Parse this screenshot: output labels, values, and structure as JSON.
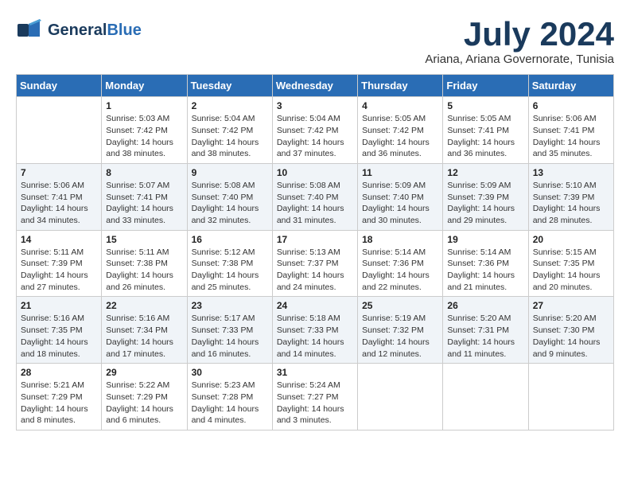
{
  "logo": {
    "text_general": "General",
    "text_blue": "Blue"
  },
  "header": {
    "month": "July 2024",
    "location": "Ariana, Ariana Governorate, Tunisia"
  },
  "columns": [
    "Sunday",
    "Monday",
    "Tuesday",
    "Wednesday",
    "Thursday",
    "Friday",
    "Saturday"
  ],
  "weeks": [
    [
      {
        "day": "",
        "info": ""
      },
      {
        "day": "1",
        "info": "Sunrise: 5:03 AM\nSunset: 7:42 PM\nDaylight: 14 hours\nand 38 minutes."
      },
      {
        "day": "2",
        "info": "Sunrise: 5:04 AM\nSunset: 7:42 PM\nDaylight: 14 hours\nand 38 minutes."
      },
      {
        "day": "3",
        "info": "Sunrise: 5:04 AM\nSunset: 7:42 PM\nDaylight: 14 hours\nand 37 minutes."
      },
      {
        "day": "4",
        "info": "Sunrise: 5:05 AM\nSunset: 7:42 PM\nDaylight: 14 hours\nand 36 minutes."
      },
      {
        "day": "5",
        "info": "Sunrise: 5:05 AM\nSunset: 7:41 PM\nDaylight: 14 hours\nand 36 minutes."
      },
      {
        "day": "6",
        "info": "Sunrise: 5:06 AM\nSunset: 7:41 PM\nDaylight: 14 hours\nand 35 minutes."
      }
    ],
    [
      {
        "day": "7",
        "info": "Sunrise: 5:06 AM\nSunset: 7:41 PM\nDaylight: 14 hours\nand 34 minutes."
      },
      {
        "day": "8",
        "info": "Sunrise: 5:07 AM\nSunset: 7:41 PM\nDaylight: 14 hours\nand 33 minutes."
      },
      {
        "day": "9",
        "info": "Sunrise: 5:08 AM\nSunset: 7:40 PM\nDaylight: 14 hours\nand 32 minutes."
      },
      {
        "day": "10",
        "info": "Sunrise: 5:08 AM\nSunset: 7:40 PM\nDaylight: 14 hours\nand 31 minutes."
      },
      {
        "day": "11",
        "info": "Sunrise: 5:09 AM\nSunset: 7:40 PM\nDaylight: 14 hours\nand 30 minutes."
      },
      {
        "day": "12",
        "info": "Sunrise: 5:09 AM\nSunset: 7:39 PM\nDaylight: 14 hours\nand 29 minutes."
      },
      {
        "day": "13",
        "info": "Sunrise: 5:10 AM\nSunset: 7:39 PM\nDaylight: 14 hours\nand 28 minutes."
      }
    ],
    [
      {
        "day": "14",
        "info": "Sunrise: 5:11 AM\nSunset: 7:39 PM\nDaylight: 14 hours\nand 27 minutes."
      },
      {
        "day": "15",
        "info": "Sunrise: 5:11 AM\nSunset: 7:38 PM\nDaylight: 14 hours\nand 26 minutes."
      },
      {
        "day": "16",
        "info": "Sunrise: 5:12 AM\nSunset: 7:38 PM\nDaylight: 14 hours\nand 25 minutes."
      },
      {
        "day": "17",
        "info": "Sunrise: 5:13 AM\nSunset: 7:37 PM\nDaylight: 14 hours\nand 24 minutes."
      },
      {
        "day": "18",
        "info": "Sunrise: 5:14 AM\nSunset: 7:36 PM\nDaylight: 14 hours\nand 22 minutes."
      },
      {
        "day": "19",
        "info": "Sunrise: 5:14 AM\nSunset: 7:36 PM\nDaylight: 14 hours\nand 21 minutes."
      },
      {
        "day": "20",
        "info": "Sunrise: 5:15 AM\nSunset: 7:35 PM\nDaylight: 14 hours\nand 20 minutes."
      }
    ],
    [
      {
        "day": "21",
        "info": "Sunrise: 5:16 AM\nSunset: 7:35 PM\nDaylight: 14 hours\nand 18 minutes."
      },
      {
        "day": "22",
        "info": "Sunrise: 5:16 AM\nSunset: 7:34 PM\nDaylight: 14 hours\nand 17 minutes."
      },
      {
        "day": "23",
        "info": "Sunrise: 5:17 AM\nSunset: 7:33 PM\nDaylight: 14 hours\nand 16 minutes."
      },
      {
        "day": "24",
        "info": "Sunrise: 5:18 AM\nSunset: 7:33 PM\nDaylight: 14 hours\nand 14 minutes."
      },
      {
        "day": "25",
        "info": "Sunrise: 5:19 AM\nSunset: 7:32 PM\nDaylight: 14 hours\nand 12 minutes."
      },
      {
        "day": "26",
        "info": "Sunrise: 5:20 AM\nSunset: 7:31 PM\nDaylight: 14 hours\nand 11 minutes."
      },
      {
        "day": "27",
        "info": "Sunrise: 5:20 AM\nSunset: 7:30 PM\nDaylight: 14 hours\nand 9 minutes."
      }
    ],
    [
      {
        "day": "28",
        "info": "Sunrise: 5:21 AM\nSunset: 7:29 PM\nDaylight: 14 hours\nand 8 minutes."
      },
      {
        "day": "29",
        "info": "Sunrise: 5:22 AM\nSunset: 7:29 PM\nDaylight: 14 hours\nand 6 minutes."
      },
      {
        "day": "30",
        "info": "Sunrise: 5:23 AM\nSunset: 7:28 PM\nDaylight: 14 hours\nand 4 minutes."
      },
      {
        "day": "31",
        "info": "Sunrise: 5:24 AM\nSunset: 7:27 PM\nDaylight: 14 hours\nand 3 minutes."
      },
      {
        "day": "",
        "info": ""
      },
      {
        "day": "",
        "info": ""
      },
      {
        "day": "",
        "info": ""
      }
    ]
  ]
}
